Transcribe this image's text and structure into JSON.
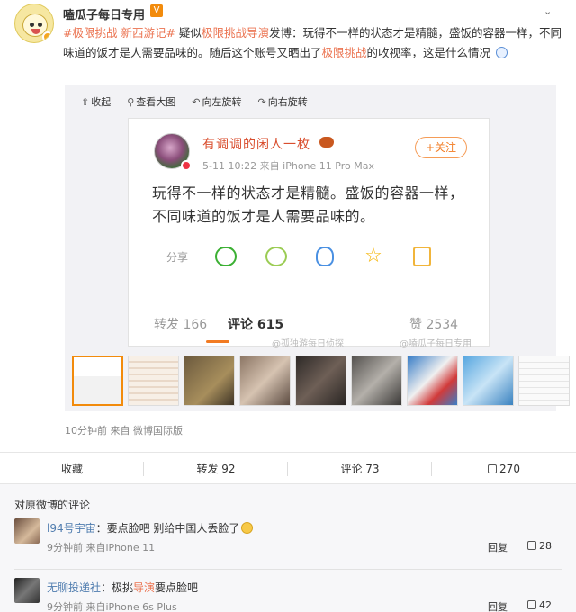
{
  "post": {
    "username": "嗑瓜子每日专用",
    "vip_badge": "V",
    "text": {
      "tag1": "#极限挑战",
      "tag2": "新西游记#",
      "part1": " 疑似",
      "link1": "极限挑战",
      "link2": "导演",
      "part2": "发博：玩得不一样的状态才是精髓，盛饭的容器一样，不同味道的饭才是人需要品味的。随后这个账号又晒出了",
      "link3": "极限挑战",
      "part3": "的收视率，这是什么情况"
    },
    "toolbar": [
      "收起",
      "查看大图",
      "向左旋转",
      "向右旋转"
    ],
    "time": "10分钟前  来自 微博国际版"
  },
  "screenshot": {
    "name": "有调调的闲人一枚",
    "meta": "5-11 10:22  来自 iPhone 11 Pro Max",
    "follow": "+关注",
    "text": "玩得不一样的状态才是精髓。盛饭的容器一样，不同味道的饭才是人需要品味的。",
    "share_label": "分享",
    "repost": "转发 166",
    "comment": "评论 615",
    "like": "赞 2534",
    "watermark1": "@孤独游每日侦探",
    "watermark2": "@嗑瓜子每日专用"
  },
  "actions": {
    "favorite": "收藏",
    "repost": "转发 92",
    "comment": "评论 73",
    "like": "270"
  },
  "comments": {
    "title": "对原微博的评论",
    "items": [
      {
        "user": "l94号宇宙",
        "text": "：要点脸吧 别给中国人丢脸了",
        "meta": "9分钟前  来自iPhone 11",
        "reply": "回复",
        "likes": "28"
      },
      {
        "user": "无聊投递社",
        "text_pre": "：极挑",
        "text_link": "导演",
        "text_post": "要点脸吧",
        "meta": "9分钟前  来自iPhone 6s Plus",
        "reply": "回复",
        "likes": "42"
      }
    ]
  }
}
